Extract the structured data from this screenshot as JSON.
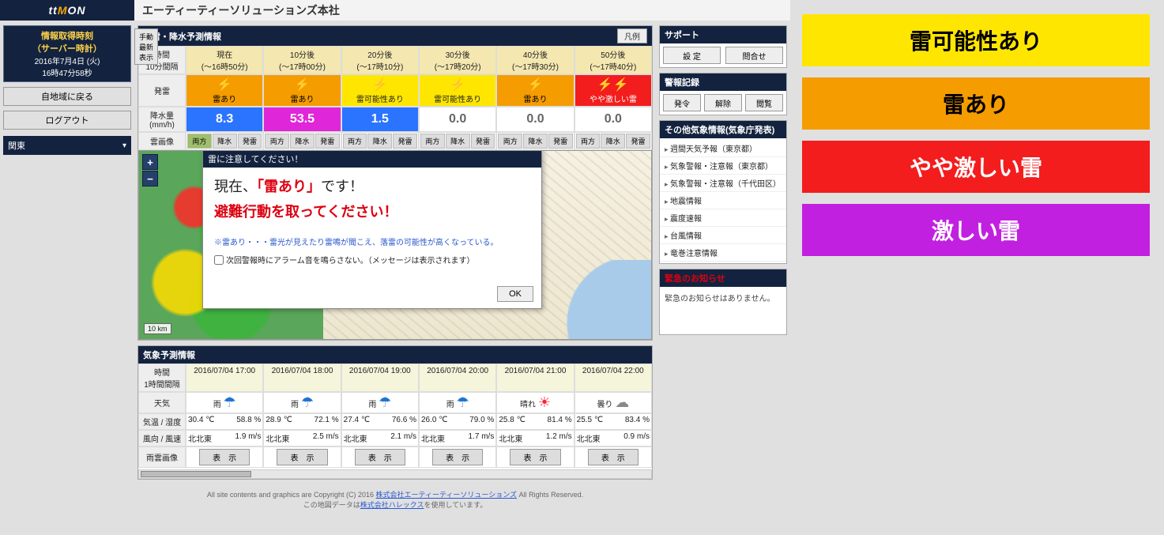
{
  "brand": "ttMON",
  "location_title": "エーティーティーソリューションズ本社",
  "server_time": {
    "label1": "情報取得時刻",
    "label2": "（サーバー時計）",
    "date": "2016年7月4日 (火)",
    "time": "16時47分58秒"
  },
  "refresh_btn": "手動\n最新表示",
  "left_nav": {
    "back_region": "自地域に戻る",
    "logout": "ログアウト",
    "region_dd": "関東"
  },
  "forecast_panel": {
    "title": "発雷・降水予測情報",
    "legend_btn": "凡例",
    "cols_head": "時間\n10分間隔",
    "columns": [
      {
        "title": "現在",
        "sub": "(～16時50分)",
        "level": "yes",
        "level_label": "雷あり",
        "rain": "8.3",
        "rain_class": "rain-lt5"
      },
      {
        "title": "10分後",
        "sub": "(～17時00分)",
        "level": "yes",
        "level_label": "雷あり",
        "rain": "53.5",
        "rain_class": "rain-gt5"
      },
      {
        "title": "20分後",
        "sub": "(～17時10分)",
        "level": "possible",
        "level_label": "雷可能性あり",
        "rain": "1.5",
        "rain_class": "rain-lt5"
      },
      {
        "title": "30分後",
        "sub": "(～17時20分)",
        "level": "possible",
        "level_label": "雷可能性あり",
        "rain": "0.0",
        "rain_class": "rain-0"
      },
      {
        "title": "40分後",
        "sub": "(～17時30分)",
        "level": "yes",
        "level_label": "雷あり",
        "rain": "0.0",
        "rain_class": "rain-0"
      },
      {
        "title": "50分後",
        "sub": "(～17時40分)",
        "level": "severe",
        "level_label": "やや激しい雷",
        "rain": "0.0",
        "rain_class": "rain-0"
      }
    ],
    "row_thunder": "発雷",
    "row_rain": "降水量\n(mm/h)",
    "row_cloud": "雲画像",
    "btn_labels": [
      "両方",
      "降水",
      "発雷"
    ],
    "map": {
      "scale": "10 km",
      "zoom_in": "+",
      "zoom_out": "−"
    },
    "dialog": {
      "title": "雷に注意してください！",
      "line1_pre": "現在、",
      "line1_hl": "「雷あり」",
      "line1_post": "です！",
      "line2": "避難行動を取ってください！",
      "note": "※雷あり・・・雷光が見えたり雷鳴が聞こえ、落雷の可能性が高くなっている。",
      "checkbox": "次回警報時にアラーム音を鳴らさない。（メッセージは表示されます）",
      "ok": "OK"
    }
  },
  "weather_panel": {
    "title": "気象予測情報",
    "row_labels": {
      "time": "時間\n1時間間隔",
      "weather": "天気",
      "temp_hum": "気温 / 湿度",
      "wind": "風向 / 風速",
      "image": "雨雲画像"
    },
    "columns": [
      {
        "time": "2016/07/04 17:00",
        "w": "雨",
        "icon": "umbrella",
        "temp": "30.4 ℃",
        "hum": "58.8 %",
        "wdir": "北北東",
        "wspd": "1.9 m/s"
      },
      {
        "time": "2016/07/04 18:00",
        "w": "雨",
        "icon": "umbrella",
        "temp": "28.9 ℃",
        "hum": "72.1 %",
        "wdir": "北北東",
        "wspd": "2.5 m/s"
      },
      {
        "time": "2016/07/04 19:00",
        "w": "雨",
        "icon": "umbrella",
        "temp": "27.4 ℃",
        "hum": "76.6 %",
        "wdir": "北北東",
        "wspd": "2.1 m/s"
      },
      {
        "time": "2016/07/04 20:00",
        "w": "雨",
        "icon": "umbrella",
        "temp": "26.0 ℃",
        "hum": "79.0 %",
        "wdir": "北北東",
        "wspd": "1.7 m/s"
      },
      {
        "time": "2016/07/04 21:00",
        "w": "晴れ",
        "icon": "sun",
        "temp": "25.8 ℃",
        "hum": "81.4 %",
        "wdir": "北北東",
        "wspd": "1.2 m/s"
      },
      {
        "time": "2016/07/04 22:00",
        "w": "曇り",
        "icon": "cloud",
        "temp": "25.5 ℃",
        "hum": "83.4 %",
        "wdir": "北北東",
        "wspd": "0.9 m/s"
      }
    ],
    "disp_btn": "表　示"
  },
  "right_panel": {
    "support": {
      "title": "サポート",
      "settings": "設 定",
      "contact": "問合せ"
    },
    "alerts": {
      "title": "警報記録",
      "issue": "発令",
      "clear": "解除",
      "view": "閲覧"
    },
    "other": {
      "title": "その他気象情報(気象庁発表)",
      "links": [
        "週間天気予報（東京都）",
        "気象警報・注意報（東京都）",
        "気象警報・注意報（千代田区）",
        "地震情報",
        "震度速報",
        "台風情報",
        "竜巻注意情報"
      ]
    },
    "urgent": {
      "title": "緊急のお知らせ",
      "body": "緊急のお知らせはありません。"
    }
  },
  "footer": {
    "l1_a": "All site contents and graphics are Copyright (C) 2016 ",
    "l1_link": "株式会社エーティーティーソリューションズ",
    "l1_b": " All Rights Reserved.",
    "l2_a": "この地図データは",
    "l2_link": "株式会社ハレックス",
    "l2_b": "を使用しています。"
  },
  "big_legend": {
    "possible": "雷可能性あり",
    "yes": "雷あり",
    "severe": "やや激しい雷",
    "vsevere": "激しい雷"
  }
}
